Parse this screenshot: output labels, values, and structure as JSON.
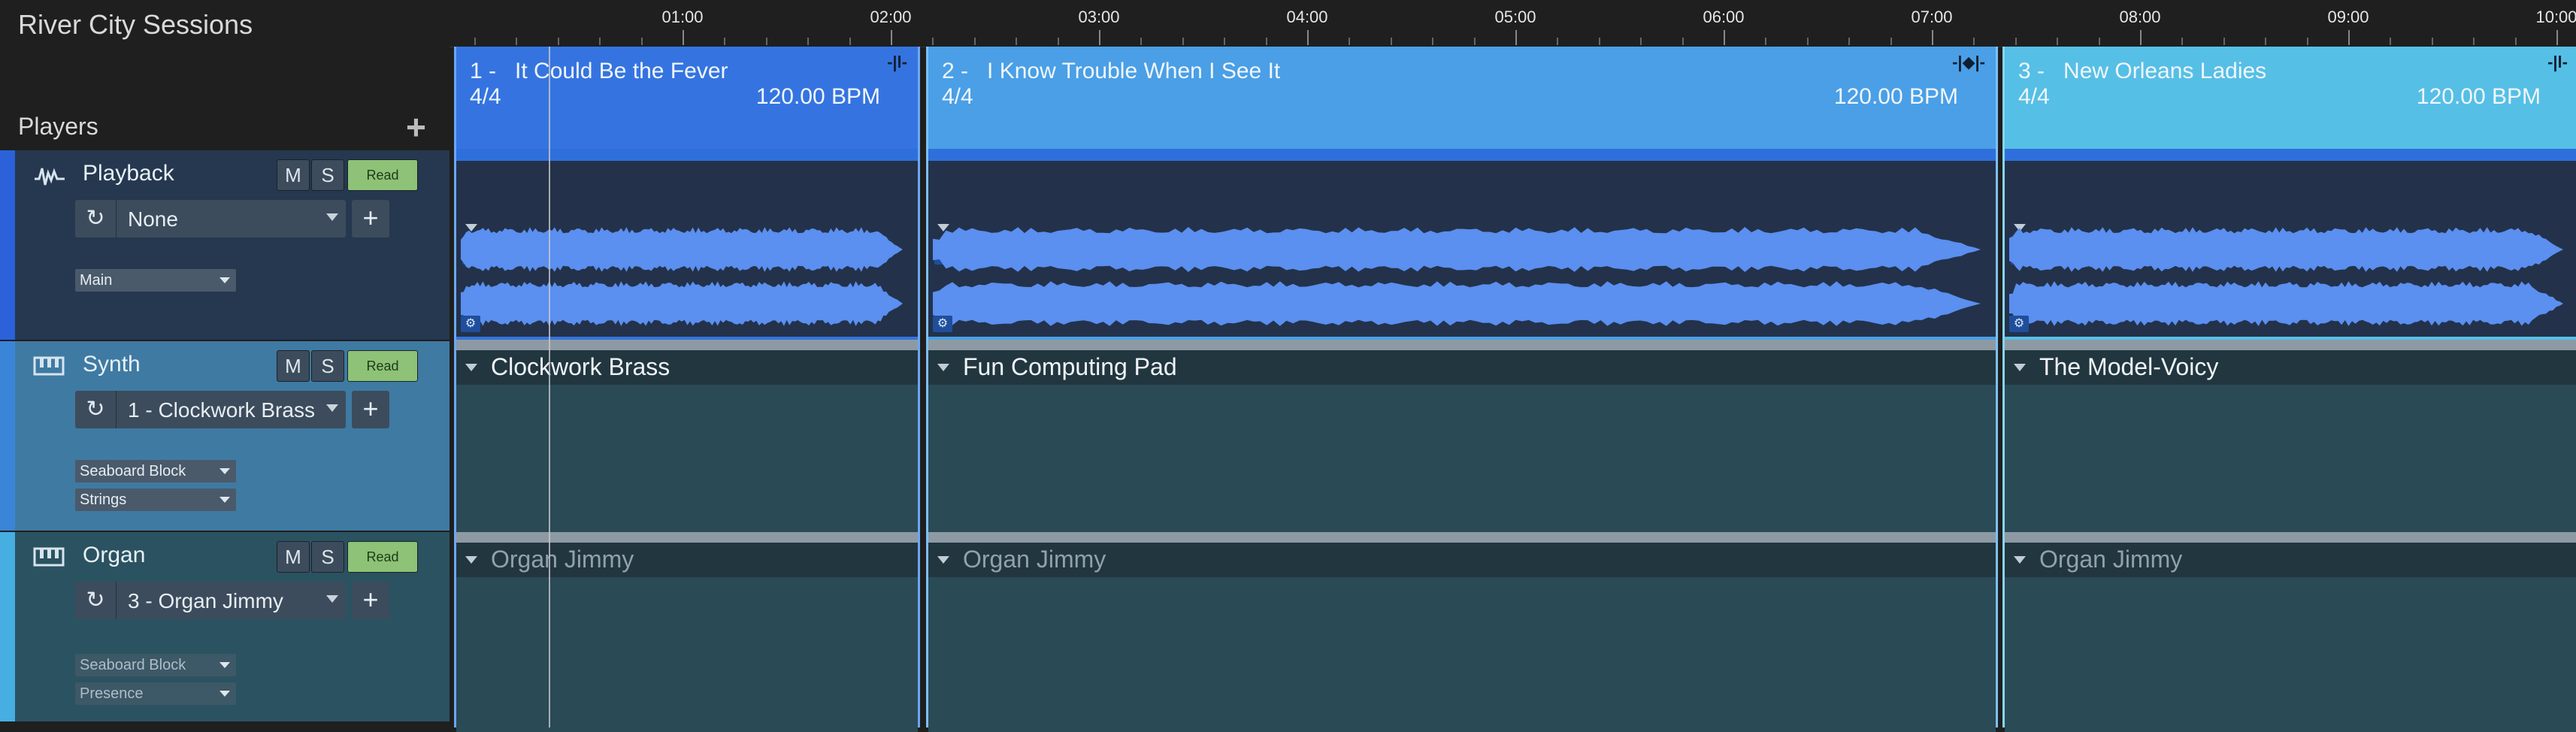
{
  "app": {
    "title": "River City Sessions"
  },
  "players": {
    "label": "Players",
    "add_icon": "plus-icon",
    "tracks": [
      {
        "name": "Playback",
        "icon": "waveform-icon",
        "mute": "M",
        "solo": "S",
        "mode": "Read",
        "preset": "None",
        "outputs": [
          "Main"
        ],
        "stripe": "#2b62d9",
        "bg": "#25384f"
      },
      {
        "name": "Synth",
        "icon": "keyboard-icon",
        "mute": "M",
        "solo": "S",
        "mode": "Read",
        "preset": "1 - Clockwork Brass",
        "outputs": [
          "Seaboard Block",
          "Strings"
        ],
        "stripe": "#3a85d8",
        "bg": "#3f7aa3"
      },
      {
        "name": "Organ",
        "icon": "keyboard-icon",
        "mute": "M",
        "solo": "S",
        "mode": "Read",
        "preset": "3 - Organ Jimmy",
        "outputs": [
          "Seaboard Block",
          "Presence"
        ],
        "stripe": "#46aee0",
        "bg": "#2b5260"
      }
    ]
  },
  "ruler": {
    "ticks": [
      "01:00",
      "02:00",
      "03:00",
      "04:00",
      "05:00",
      "06:00",
      "07:00",
      "08:00",
      "09:00",
      "10:00"
    ]
  },
  "songs": [
    {
      "num": "1 -",
      "title": "It Could Be the Fever",
      "sig": "4/4",
      "bpm": "120.00 BPM",
      "color": "#3574e0",
      "audio_label": "It Could Be the Fever",
      "synth_patch": "Clockwork Brass",
      "organ_patch": "Organ Jimmy"
    },
    {
      "num": "2 -",
      "title": "I Know Trouble When I See It",
      "sig": "4/4",
      "bpm": "120.00 BPM",
      "color": "#4a9fe6",
      "audio_label": "I Know Trouble When I See It",
      "synth_patch": "Fun Computing Pad",
      "organ_patch": "Organ Jimmy"
    },
    {
      "num": "3 -",
      "title": "New Orleans Ladies",
      "sig": "4/4",
      "bpm": "120.00 BPM",
      "color": "#56bfe6",
      "audio_label": "New Orleans Ladies",
      "synth_patch": "The Model-Voicy",
      "organ_patch": "Organ Jimmy"
    }
  ],
  "colors": {
    "waveform": "#5b8ff0",
    "read_button": "#8dc277"
  }
}
